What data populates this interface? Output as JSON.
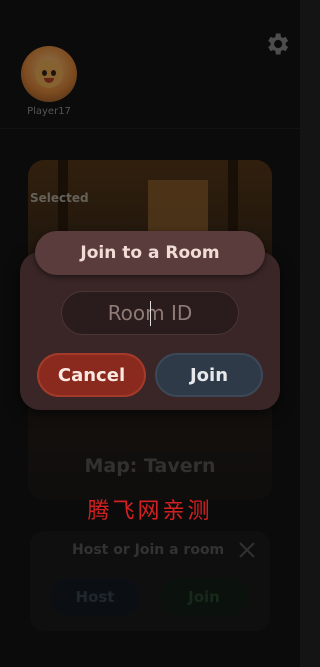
{
  "player": {
    "name": "Player17"
  },
  "map": {
    "selected_label": "Selected",
    "name_label": "Map: Tavern"
  },
  "join_dialog": {
    "title": "Join to a Room",
    "room_id_placeholder": "Room ID",
    "room_id_value": "",
    "cancel_label": "Cancel",
    "join_label": "Join"
  },
  "watermark": "腾飞网亲测",
  "host_join_panel": {
    "title": "Host or Join a room",
    "host_label": "Host",
    "join_label": "Join"
  },
  "colors": {
    "cancel": "#8a2a1e",
    "join": "#2f3a48",
    "dialog": "#3a2627",
    "watermark": "#d42020"
  },
  "icons": {
    "settings": "gear-icon",
    "close": "close-icon"
  }
}
